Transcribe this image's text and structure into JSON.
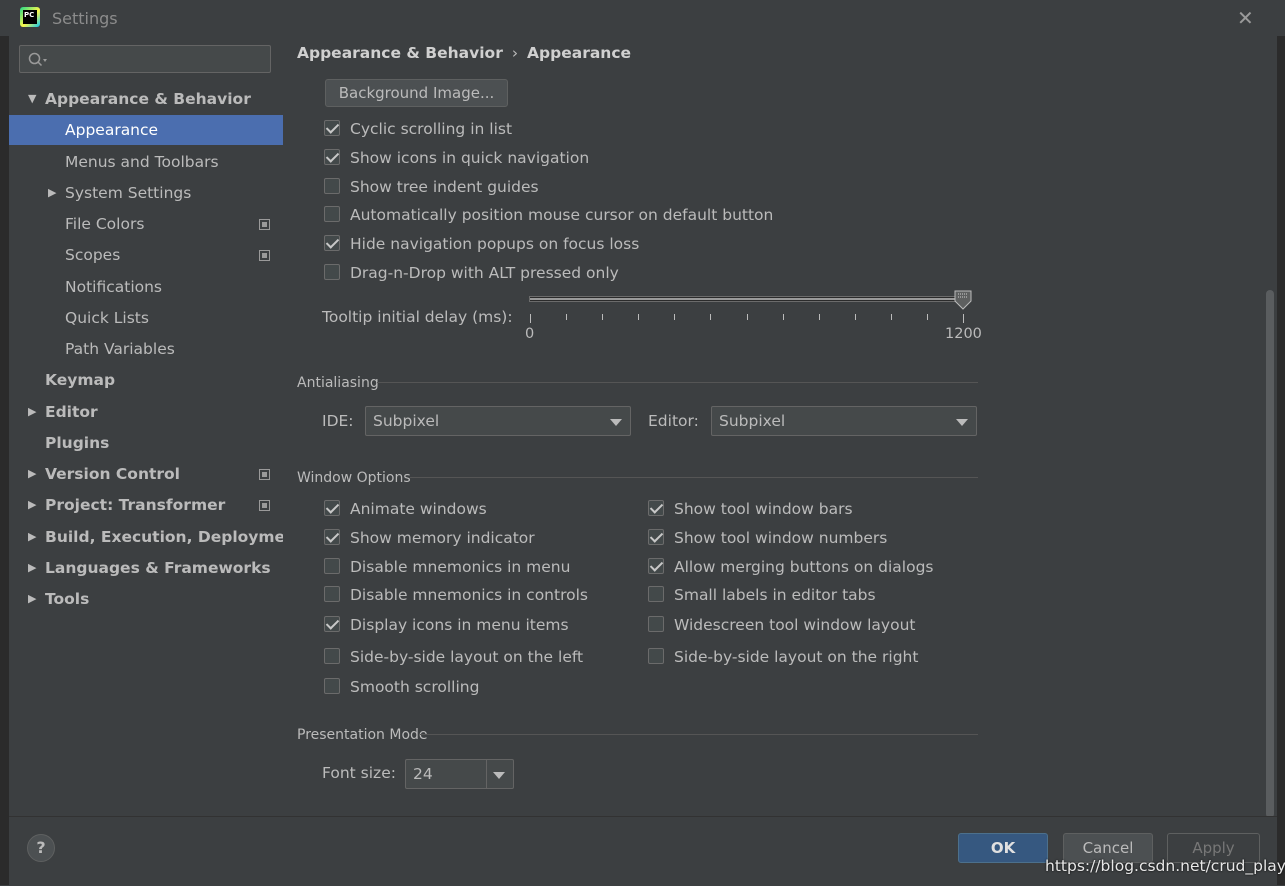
{
  "window": {
    "title": "Settings",
    "close_glyph": "✕"
  },
  "sidebar": {
    "search_placeholder": "",
    "items": [
      {
        "label": "Appearance & Behavior",
        "level": 0,
        "bold": true,
        "arrow": "expanded"
      },
      {
        "label": "Appearance",
        "level": 1,
        "selected": true
      },
      {
        "label": "Menus and Toolbars",
        "level": 1
      },
      {
        "label": "System Settings",
        "level": 1,
        "arrow": "collapsed"
      },
      {
        "label": "File Colors",
        "level": 1,
        "project_icon": true
      },
      {
        "label": "Scopes",
        "level": 1,
        "project_icon": true
      },
      {
        "label": "Notifications",
        "level": 1
      },
      {
        "label": "Quick Lists",
        "level": 1
      },
      {
        "label": "Path Variables",
        "level": 1
      },
      {
        "label": "Keymap",
        "level": 0,
        "bold": true
      },
      {
        "label": "Editor",
        "level": 0,
        "bold": true,
        "arrow": "collapsed"
      },
      {
        "label": "Plugins",
        "level": 0,
        "bold": true
      },
      {
        "label": "Version Control",
        "level": 0,
        "bold": true,
        "arrow": "collapsed",
        "project_icon": true
      },
      {
        "label": "Project: Transformer",
        "level": 0,
        "bold": true,
        "arrow": "collapsed",
        "project_icon": true
      },
      {
        "label": "Build, Execution, Deployment",
        "level": 0,
        "bold": true,
        "arrow": "collapsed"
      },
      {
        "label": "Languages & Frameworks",
        "level": 0,
        "bold": true,
        "arrow": "collapsed"
      },
      {
        "label": "Tools",
        "level": 0,
        "bold": true,
        "arrow": "collapsed"
      }
    ]
  },
  "breadcrumb": {
    "parent": "Appearance & Behavior",
    "separator": "›",
    "current": "Appearance"
  },
  "background_image_button": "Background Image...",
  "ui_options": [
    {
      "label": "Cyclic scrolling in list",
      "checked": true
    },
    {
      "label": "Show icons in quick navigation",
      "checked": true
    },
    {
      "label": "Show tree indent guides",
      "checked": false
    },
    {
      "label": "Automatically position mouse cursor on default button",
      "checked": false
    },
    {
      "label": "Hide navigation popups on focus loss",
      "checked": true
    },
    {
      "label": "Drag-n-Drop with ALT pressed only",
      "checked": false
    }
  ],
  "tooltip_delay": {
    "label": "Tooltip initial delay (ms):",
    "min_label": "0",
    "max_label": "1200",
    "min": 0,
    "max": 1200,
    "value": 1200
  },
  "antialiasing": {
    "title": "Antialiasing",
    "ide_label": "IDE:",
    "ide_value": "Subpixel",
    "editor_label": "Editor:",
    "editor_value": "Subpixel"
  },
  "window_options": {
    "title": "Window Options",
    "left": [
      {
        "label": "Animate windows",
        "checked": true
      },
      {
        "label": "Show memory indicator",
        "checked": true
      },
      {
        "label": "Disable mnemonics in menu",
        "checked": false
      },
      {
        "label": "Disable mnemonics in controls",
        "checked": false
      },
      {
        "label": "Display icons in menu items",
        "checked": true
      },
      {
        "label": "Side-by-side layout on the left",
        "checked": false
      },
      {
        "label": "Smooth scrolling",
        "checked": false
      }
    ],
    "right": [
      {
        "label": "Show tool window bars",
        "checked": true
      },
      {
        "label": "Show tool window numbers",
        "checked": true
      },
      {
        "label": "Allow merging buttons on dialogs",
        "checked": true
      },
      {
        "label": "Small labels in editor tabs",
        "checked": false
      },
      {
        "label": "Widescreen tool window layout",
        "checked": false
      },
      {
        "label": "Side-by-side layout on the right",
        "checked": false
      }
    ]
  },
  "presentation": {
    "title": "Presentation Mode",
    "font_size_label": "Font size:",
    "font_size_value": "24"
  },
  "footer": {
    "help": "?",
    "ok": "OK",
    "cancel": "Cancel",
    "apply": "Apply"
  },
  "watermark": "https://blog.csdn.net/crud_player",
  "colors": {
    "accent_selected": "#4b6eaf",
    "ok_button": "#365880",
    "background": "#3c3f41"
  }
}
